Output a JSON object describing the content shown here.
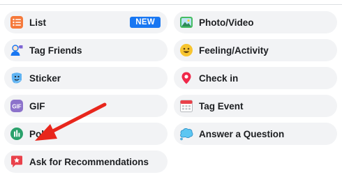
{
  "options": [
    {
      "label": "List",
      "badge": "NEW",
      "icon": "list-icon"
    },
    {
      "label": "Photo/Video",
      "icon": "photo-icon"
    },
    {
      "label": "Tag Friends",
      "icon": "tag-friends-icon"
    },
    {
      "label": "Feeling/Activity",
      "icon": "smiley-icon"
    },
    {
      "label": "Sticker",
      "icon": "sticker-icon"
    },
    {
      "label": "Check in",
      "icon": "location-pin-icon"
    },
    {
      "label": "GIF",
      "icon": "gif-icon"
    },
    {
      "label": "Tag Event",
      "icon": "calendar-icon"
    },
    {
      "label": "Poll",
      "icon": "poll-icon"
    },
    {
      "label": "Answer a Question",
      "icon": "speech-bubble-icon"
    },
    {
      "label": "Ask for Recommendations",
      "icon": "recommendation-icon"
    }
  ],
  "colors": {
    "badge": "#1877f2",
    "pill_background": "#f2f3f5",
    "annotation_arrow": "#e8261c"
  }
}
